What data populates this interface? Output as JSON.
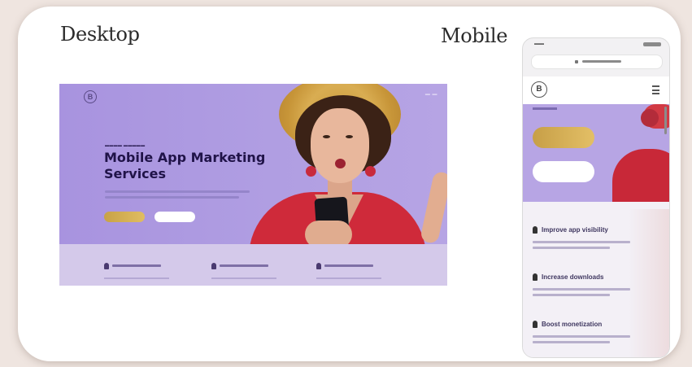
{
  "headings": {
    "desktop": "Desktop",
    "mobile": "Mobile"
  },
  "desktop": {
    "logo_glyph": "B",
    "title": "Mobile App Marketing Services",
    "primary_button": "",
    "secondary_button": ""
  },
  "mobile": {
    "logo_glyph": "B",
    "features": [
      {
        "label": "Improve app visibility"
      },
      {
        "label": "Increase downloads"
      },
      {
        "label": "Boost monetization"
      }
    ],
    "primary_button": "",
    "secondary_button": ""
  },
  "colors": {
    "hero_purple": "#a894dc",
    "gold_button": "#d6b256",
    "dress_red": "#cf2a3a",
    "title_navy": "#201348"
  },
  "icons": [
    "menu-icon",
    "lock-icon",
    "feature-icon"
  ]
}
